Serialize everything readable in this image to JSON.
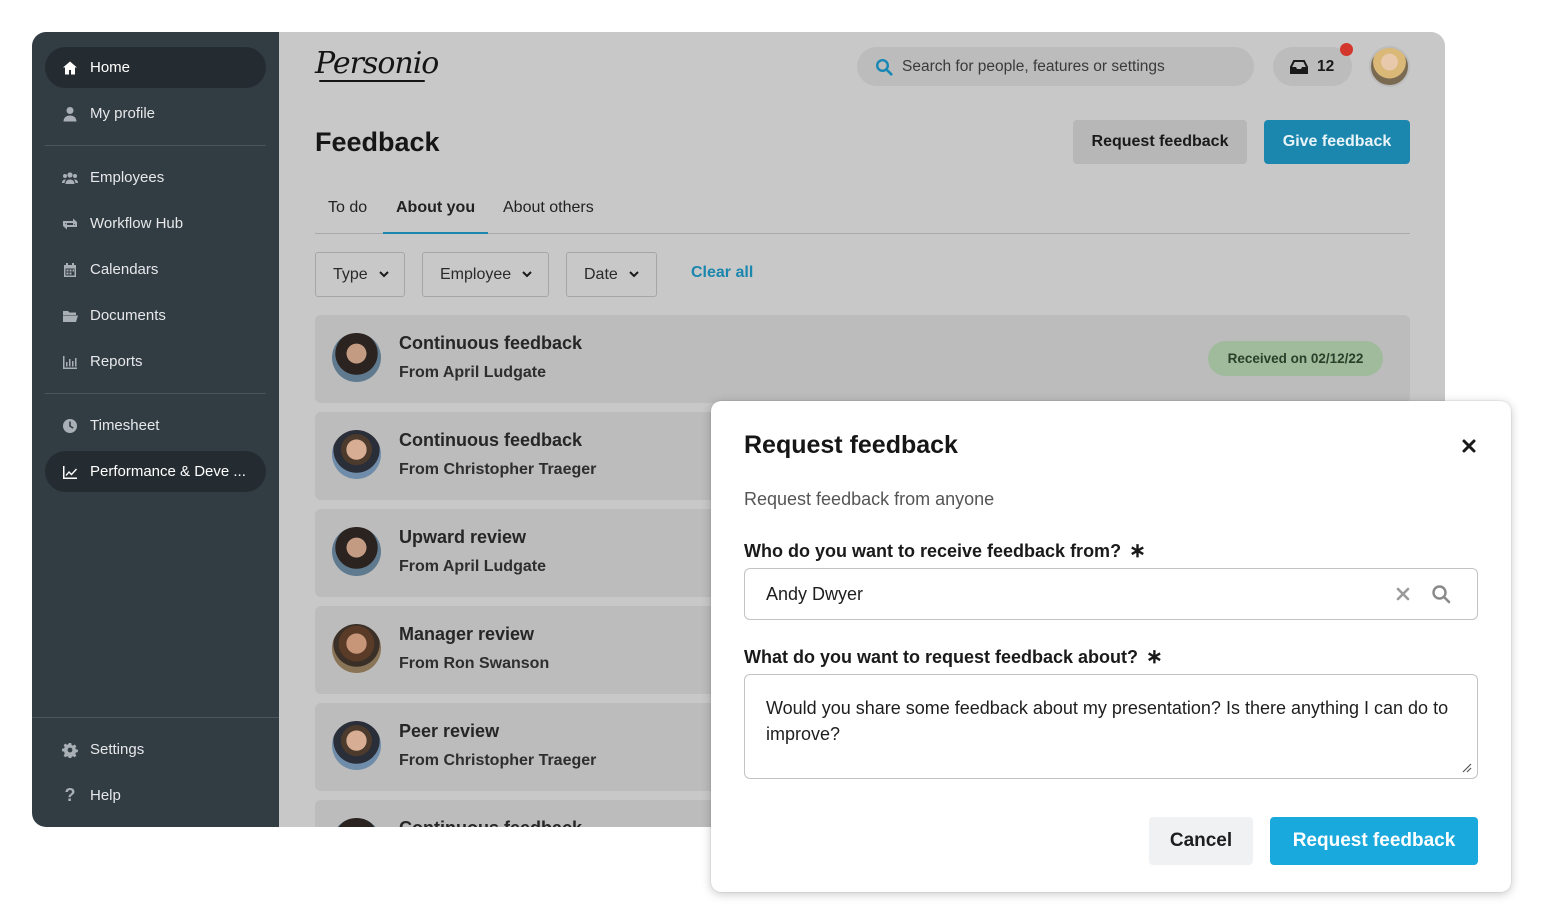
{
  "sidebar": {
    "items": [
      {
        "label": "Home",
        "icon": "home-icon"
      },
      {
        "label": "My profile",
        "icon": "user-icon"
      },
      {
        "label": "Employees",
        "icon": "users-icon"
      },
      {
        "label": "Workflow Hub",
        "icon": "workflow-icon"
      },
      {
        "label": "Calendars",
        "icon": "calendar-icon"
      },
      {
        "label": "Documents",
        "icon": "folder-icon"
      },
      {
        "label": "Reports",
        "icon": "chart-icon"
      },
      {
        "label": "Timesheet",
        "icon": "clock-icon"
      },
      {
        "label": "Performance & Deve ...",
        "icon": "trend-icon"
      },
      {
        "label": "Settings",
        "icon": "gear-icon"
      },
      {
        "label": "Help",
        "icon": "question-icon"
      }
    ]
  },
  "header": {
    "logo": "Personio",
    "search_placeholder": "Search for people, features or settings",
    "inbox_count": "12"
  },
  "page": {
    "title": "Feedback",
    "request_button": "Request feedback",
    "give_button": "Give feedback",
    "tabs": [
      "To do",
      "About you",
      "About others"
    ],
    "filters": [
      "Type",
      "Employee",
      "Date"
    ],
    "clear_all": "Clear all"
  },
  "feedback_list": [
    {
      "title": "Continuous feedback",
      "from": "From April Ludgate",
      "badge": "Received on 02/12/22"
    },
    {
      "title": "Continuous feedback",
      "from": "From Christopher Traeger"
    },
    {
      "title": "Upward review",
      "from": "From April Ludgate"
    },
    {
      "title": "Manager review",
      "from": "From Ron Swanson"
    },
    {
      "title": "Peer review",
      "from": "From Christopher Traeger"
    },
    {
      "title": "Continuous feedback"
    }
  ],
  "modal": {
    "title": "Request feedback",
    "subtitle": "Request feedback from anyone",
    "who_label": "Who do you want to receive feedback from?",
    "who_value": "Andy Dwyer",
    "about_label": "What do you want to request feedback about?",
    "about_value": "Would you share some feedback about my presentation? Is there anything I can do to improve?",
    "required_mark": "∗",
    "cancel": "Cancel",
    "submit": "Request feedback"
  },
  "colors": {
    "sidebar": "#323c43",
    "accent": "#19a9dc",
    "badge_bg": "#9fbb9c"
  }
}
